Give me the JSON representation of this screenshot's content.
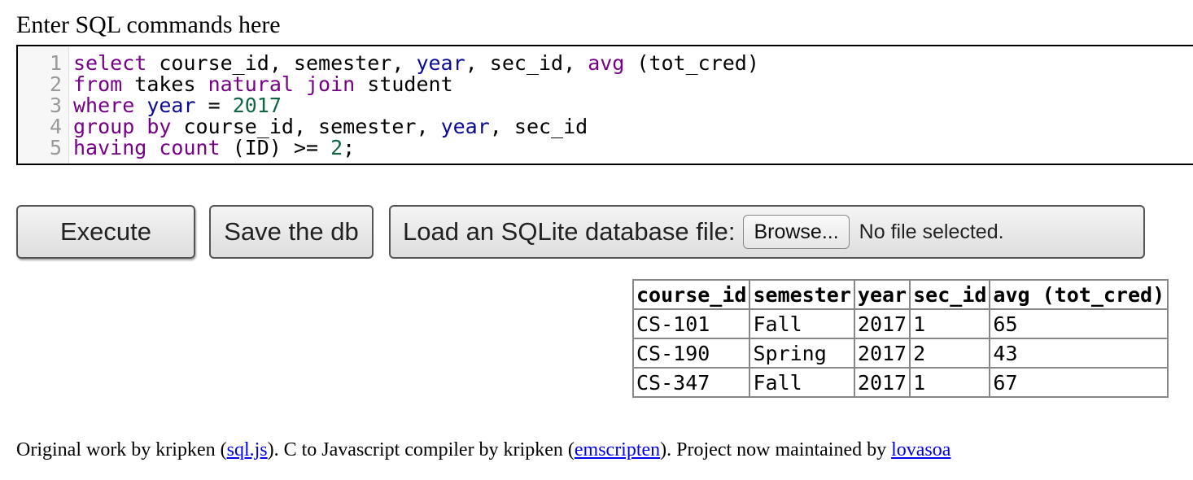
{
  "heading": "Enter SQL commands here",
  "editor": {
    "lines": [
      {
        "num": "1",
        "tokens": [
          {
            "t": "select",
            "c": "kw"
          },
          {
            "t": " course_id, semester, ",
            "c": ""
          },
          {
            "t": "year",
            "c": "vr"
          },
          {
            "t": ", sec_id, ",
            "c": ""
          },
          {
            "t": "avg",
            "c": "kw"
          },
          {
            "t": " (tot_cred)",
            "c": ""
          }
        ]
      },
      {
        "num": "2",
        "tokens": [
          {
            "t": "from",
            "c": "kw"
          },
          {
            "t": " takes ",
            "c": ""
          },
          {
            "t": "natural",
            "c": "kw"
          },
          {
            "t": " ",
            "c": ""
          },
          {
            "t": "join",
            "c": "kw"
          },
          {
            "t": " student",
            "c": ""
          }
        ]
      },
      {
        "num": "3",
        "tokens": [
          {
            "t": "where",
            "c": "kw"
          },
          {
            "t": " ",
            "c": ""
          },
          {
            "t": "year",
            "c": "vr"
          },
          {
            "t": " = ",
            "c": ""
          },
          {
            "t": "2017",
            "c": "nm"
          }
        ]
      },
      {
        "num": "4",
        "tokens": [
          {
            "t": "group",
            "c": "kw"
          },
          {
            "t": " ",
            "c": ""
          },
          {
            "t": "by",
            "c": "kw"
          },
          {
            "t": " course_id, semester, ",
            "c": ""
          },
          {
            "t": "year",
            "c": "vr"
          },
          {
            "t": ", sec_id",
            "c": ""
          }
        ]
      },
      {
        "num": "5",
        "tokens": [
          {
            "t": "having",
            "c": "kw"
          },
          {
            "t": " ",
            "c": ""
          },
          {
            "t": "count",
            "c": "kw"
          },
          {
            "t": " (ID) >= ",
            "c": ""
          },
          {
            "t": "2",
            "c": "nm"
          },
          {
            "t": ";",
            "c": ""
          }
        ]
      }
    ]
  },
  "buttons": {
    "execute": "Execute",
    "save": "Save the db",
    "load_label": "Load an SQLite database file:",
    "browse": "Browse...",
    "no_file": "No file selected."
  },
  "results": {
    "columns": [
      "course_id",
      "semester",
      "year",
      "sec_id",
      "avg (tot_cred)"
    ],
    "rows": [
      [
        "CS-101",
        "Fall",
        "2017",
        "1",
        "65"
      ],
      [
        "CS-190",
        "Spring",
        "2017",
        "2",
        "43"
      ],
      [
        "CS-347",
        "Fall",
        "2017",
        "1",
        "67"
      ]
    ]
  },
  "footer": {
    "part1": "Original work by kripken (",
    "link1": "sql.js",
    "part2": "). C to Javascript compiler by kripken (",
    "link2": "emscripten",
    "part3": "). Project now maintained by ",
    "link3": "lovasoa"
  }
}
